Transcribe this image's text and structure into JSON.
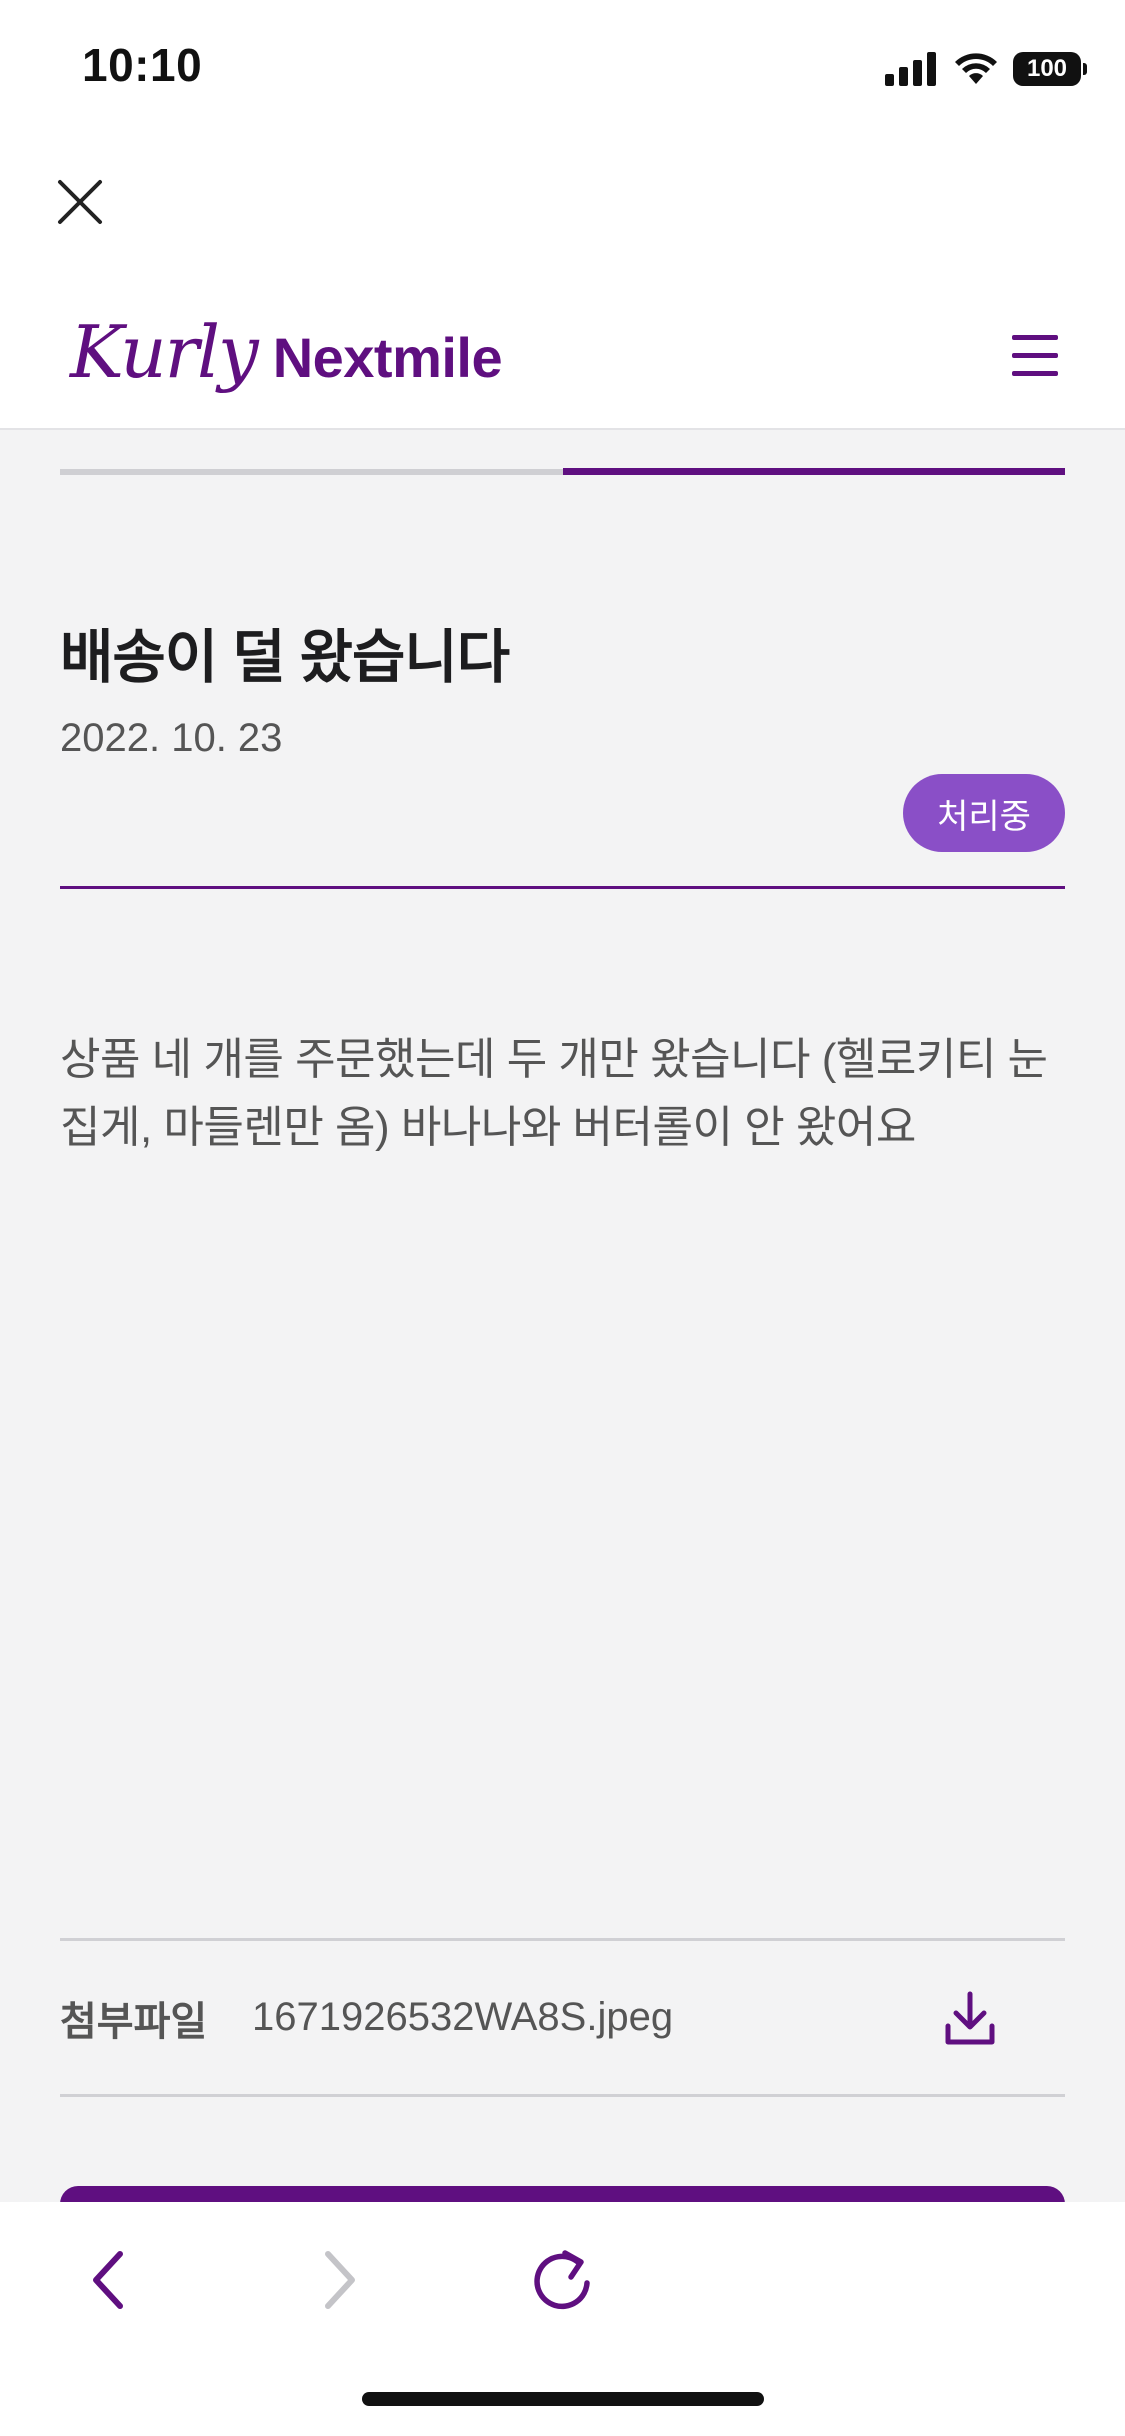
{
  "status_bar": {
    "time": "10:10",
    "battery": "100",
    "icons": [
      "signal-icon",
      "wifi-icon",
      "battery-icon"
    ]
  },
  "close_icon": "close-icon",
  "header": {
    "logo_script": "Kurly",
    "logo_word": "Nextmile",
    "menu_icon": "hamburger-menu-icon",
    "brand_color": "#5f0f80"
  },
  "post": {
    "title": "배송이 덜 왔습니다",
    "date": "2022. 10. 23",
    "status": "처리중",
    "status_color": "#8a4fc7",
    "body": "상품 네 개를 주문했는데 두 개만 왔습니다 (헬로키티 눈 집게, 마들렌만 옴) 바나나와 버터롤이 안 왔어요"
  },
  "attachment": {
    "label": "첨부파일",
    "filename": "1671926532WA8S.jpeg",
    "icon": "download-icon"
  },
  "browser_toolbar": {
    "icons": [
      "back-icon",
      "forward-icon",
      "reload-icon"
    ]
  }
}
